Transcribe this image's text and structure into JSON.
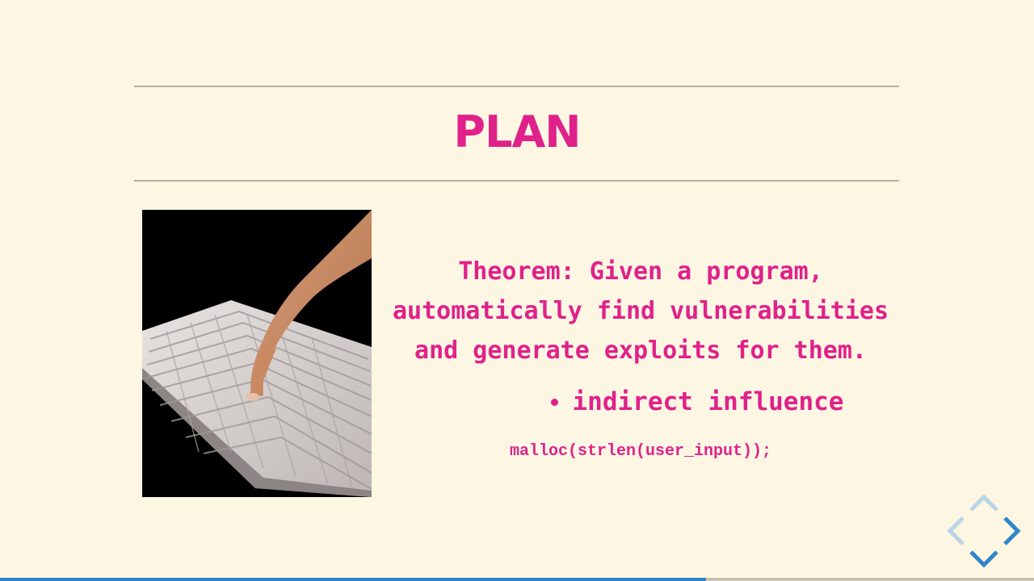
{
  "slide": {
    "title": "PLAN",
    "theorem": "Theorem: Given a program, automatically find vulnerabilities and generate exploits for them.",
    "bullets": [
      "indirect influence"
    ],
    "code": "malloc(strlen(user_input));"
  },
  "image": {
    "subject": "finger-pressing-keyboard"
  },
  "navigation": {
    "up_icon": "chevron-up-icon",
    "down_icon": "chevron-down-icon",
    "left_icon": "chevron-left-icon",
    "right_icon": "chevron-right-icon",
    "progress": 0.683
  },
  "colors": {
    "background": "#fdf6e3",
    "accent": "#e0218a",
    "rule": "#b5b0a8",
    "nav": "#2e86c9",
    "nav_disabled": "#b8d4e6"
  }
}
